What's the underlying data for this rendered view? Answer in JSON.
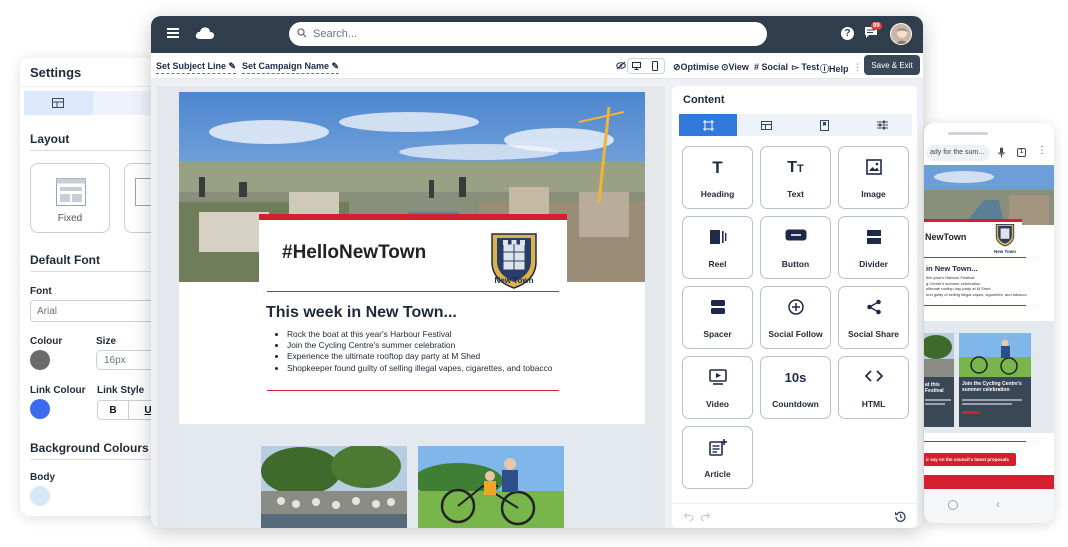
{
  "settings": {
    "title": "Settings",
    "layout_title": "Layout",
    "layout_option": "Fixed",
    "default_font_title": "Default Font",
    "font_label": "Font",
    "font_value": "Arial",
    "colour_label": "Colour",
    "size_label": "Size",
    "size_value": "16px",
    "link_colour_label": "Link Colour",
    "link_style_label": "Link Style",
    "bold_label": "B",
    "underline_label": "U",
    "background_title": "Background Colours",
    "body_label": "Body",
    "colors": {
      "font": "#6b6b6b",
      "link": "#3b6cf0",
      "body": "#d8e8fb"
    }
  },
  "topbar": {
    "search_placeholder": "Search...",
    "notification_count": "99",
    "help_symbol": "?"
  },
  "toolbar": {
    "subject_line": "Set Subject Line",
    "campaign_name": "Set Campaign Name",
    "optimise": "Optimise",
    "view": "View",
    "social": "Social",
    "test": "Test",
    "help": "Help",
    "save_exit": "Save & Exit"
  },
  "email": {
    "hero_title": "#HelloNewTown",
    "brand_name": "New Town",
    "section_title": "This week in New Town...",
    "bullets": [
      "Rock the boat at this year's Harbour Festival",
      "Join the Cycling Centre's summer celebration",
      "Experience the ultimate rooftop day party at M Shed",
      "Shopkeeper found guilty of selling illegal vapes, cigarettes, and tobacco"
    ]
  },
  "content": {
    "title": "Content",
    "tiles": [
      {
        "label": "Heading",
        "icon": "heading-icon"
      },
      {
        "label": "Text",
        "icon": "text-icon"
      },
      {
        "label": "Image",
        "icon": "image-icon"
      },
      {
        "label": "Reel",
        "icon": "reel-icon"
      },
      {
        "label": "Button",
        "icon": "button-icon"
      },
      {
        "label": "Divider",
        "icon": "divider-icon"
      },
      {
        "label": "Spacer",
        "icon": "spacer-icon"
      },
      {
        "label": "Social Follow",
        "icon": "social-follow-icon"
      },
      {
        "label": "Social Share",
        "icon": "share-icon"
      },
      {
        "label": "Video",
        "icon": "video-icon"
      },
      {
        "label": "Countdown",
        "icon": "countdown-icon",
        "glyph": "10s"
      },
      {
        "label": "HTML",
        "icon": "code-icon"
      },
      {
        "label": "Article",
        "icon": "article-icon"
      }
    ]
  },
  "mobile": {
    "url_text": "ady for the sum...",
    "hero_title": "NewTown",
    "brand_name": "New Town",
    "section_title": "in New Town...",
    "lines": [
      "this year's Harbour Festival",
      "g Centre's summer celebration",
      "ultimate rooftop day party at M Shed",
      "und guilty of selling illegal vapes, cigarettes, and tobacco"
    ],
    "card1_title_a": "at this",
    "card1_title_b": "Festival",
    "card2_title": "Join the Cycling Centre's summer celebration",
    "cta_text": "ir say on the council's latest proposals"
  }
}
